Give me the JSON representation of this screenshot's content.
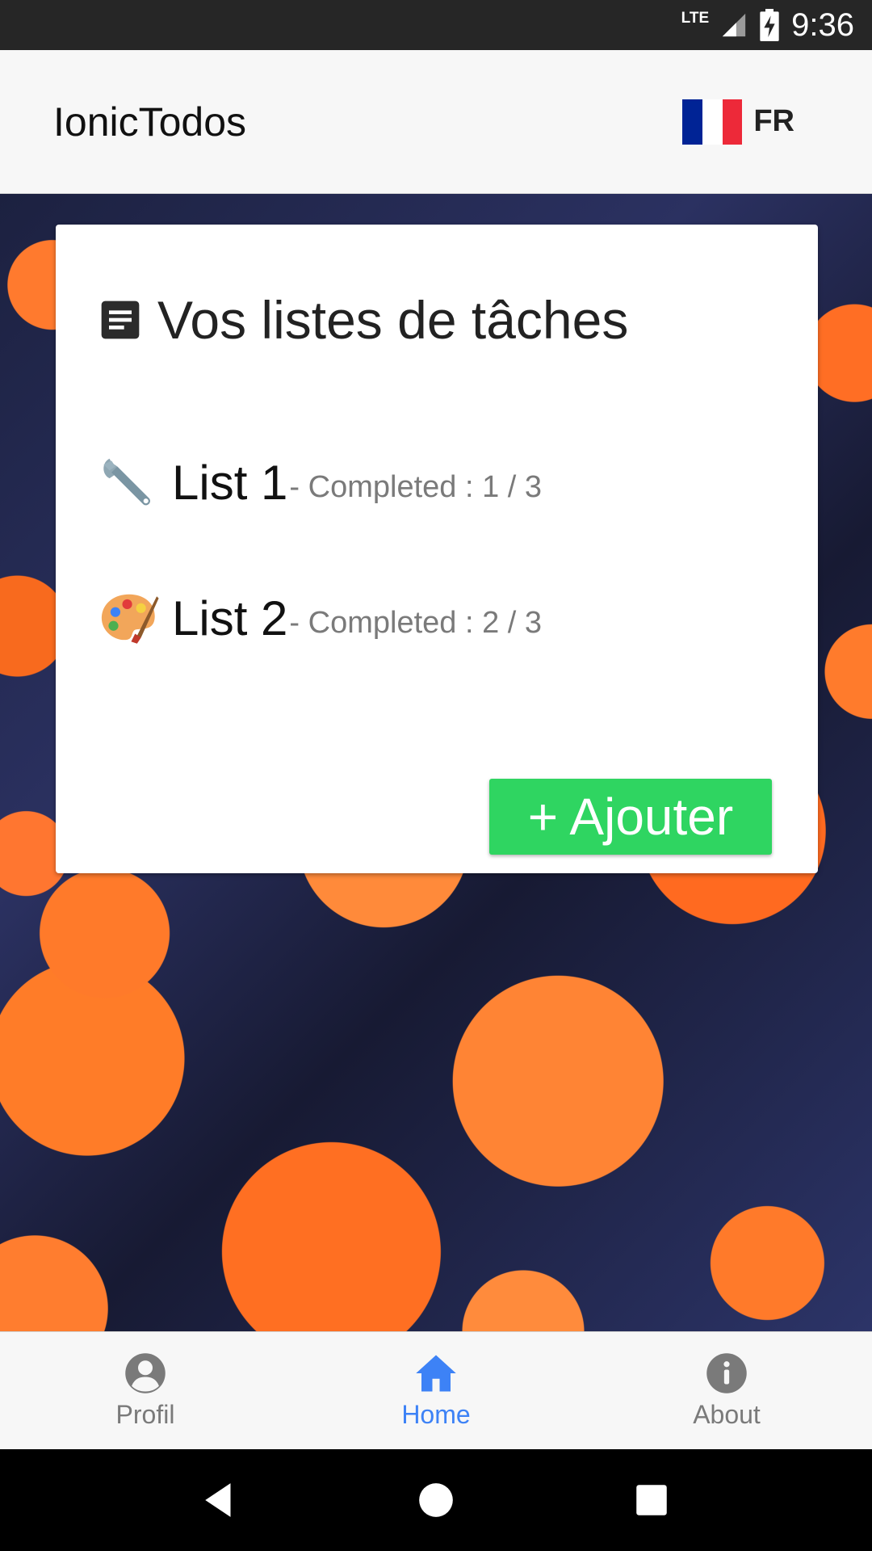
{
  "status_bar": {
    "network": "LTE",
    "time": "9:36"
  },
  "header": {
    "title": "IonicTodos",
    "language_code": "FR",
    "flag_colors": [
      "#002395",
      "#ffffff",
      "#ed2939"
    ]
  },
  "card": {
    "title": "Vos listes de tâches",
    "title_icon": "document-icon",
    "lists": [
      {
        "emoji": "wrench",
        "name": "List 1",
        "meta": "- Completed : 1 / 3"
      },
      {
        "emoji": "artist-palette",
        "name": "List 2",
        "meta": "- Completed : 2 / 3"
      }
    ],
    "add_button_label": "+ Ajouter"
  },
  "tabs": [
    {
      "label": "Profil",
      "icon": "person-circle-icon",
      "active": false
    },
    {
      "label": "Home",
      "icon": "home-icon",
      "active": true
    },
    {
      "label": "About",
      "icon": "info-icon",
      "active": false
    }
  ],
  "colors": {
    "accent": "#3d82f6",
    "add_button": "#2fd561"
  }
}
